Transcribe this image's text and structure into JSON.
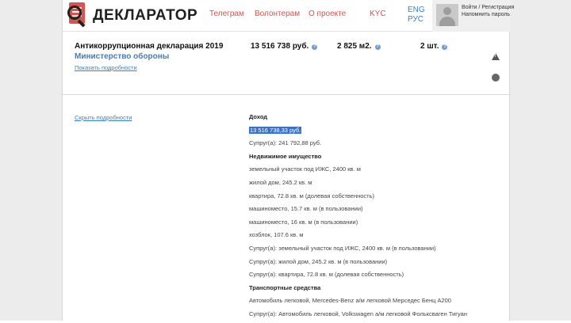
{
  "header": {
    "logo_text": "ДЕКЛАРАТОР",
    "nav": [
      {
        "label": "Телеграм"
      },
      {
        "label": "Волонтерам"
      },
      {
        "label": "О проекте"
      },
      {
        "label": "KYC"
      }
    ],
    "lang": [
      "ENG",
      "РУС"
    ],
    "auth": {
      "login": "Войти / Регистрация",
      "reset": "Напомнить пароль"
    }
  },
  "summary": {
    "title": "Антикоррупционная декларация 2019",
    "organization": "Министерство обороны",
    "show_details": "Показать подробности",
    "income": "13 516 738 руб.",
    "area": "2 825 м2.",
    "vehicles": "2 шт."
  },
  "details": {
    "hide_link": "Скрыть подробности",
    "income_heading": "Доход",
    "income_value": "13 516 738,33 руб.",
    "spouse_income": "Супруг(а): 241 792,88 руб.",
    "realty_heading": "Недвижимое имущество",
    "realty": [
      "земельный участок под ИЖС, 2400 кв. м",
      "жилой дом, 245.2 кв. м",
      "квартира, 72.8 кв. м (долевая собственность)",
      "машиноместо, 15.7 кв. м (в пользовании)",
      "машиноместо, 16 кв. м (в пользовании)",
      "хозблок, 107.6 кв. м",
      "Супруг(а): земельный участок под ИЖС, 2400 кв. м (в пользовании)",
      "Супруг(а): жилой дом, 245.2 кв. м (в пользовании)",
      "Супруг(а): квартира, 72.8 кв. м (долевая собственность)"
    ],
    "transport_heading": "Транспортные средства",
    "transport": [
      "Автомобиль легковой, Mercedes-Benz а/м легковой Мерседес Бенц А200",
      "Супруг(а): Автомобиль легковой, Volkswagen а/м легковой Фольксваген Тигуан"
    ]
  }
}
